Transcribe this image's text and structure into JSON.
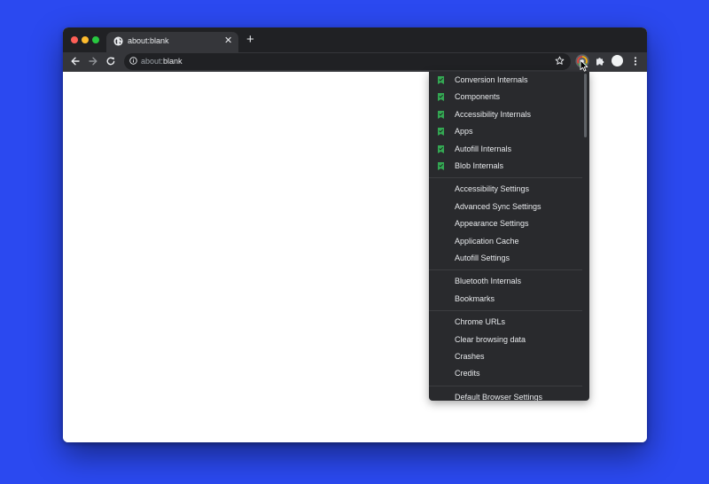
{
  "browser": {
    "tab": {
      "title": "about:blank",
      "close_glyph": "✕",
      "icon": "globe-icon"
    },
    "new_tab_glyph": "+",
    "address": {
      "scheme": "about:",
      "rest": "blank"
    },
    "toolbar_icons": [
      "back-icon",
      "forward-icon",
      "reload-icon",
      "info-icon",
      "star-icon",
      "extension-app-icon",
      "puzzle-icon",
      "avatar",
      "more-icon"
    ]
  },
  "menu": {
    "groups": [
      {
        "items": [
          {
            "label": "Conversion Internals",
            "checked": true
          },
          {
            "label": "Components",
            "checked": true
          },
          {
            "label": "Accessibility Internals",
            "checked": true
          },
          {
            "label": "Apps",
            "checked": true
          },
          {
            "label": "Autofill Internals",
            "checked": true
          },
          {
            "label": "Blob Internals",
            "checked": true
          }
        ]
      },
      {
        "items": [
          {
            "label": "Accessibility Settings",
            "checked": false
          },
          {
            "label": "Advanced Sync Settings",
            "checked": false
          },
          {
            "label": "Appearance Settings",
            "checked": false
          },
          {
            "label": "Application Cache",
            "checked": false
          },
          {
            "label": "Autofill Settings",
            "checked": false
          }
        ]
      },
      {
        "items": [
          {
            "label": "Bluetooth Internals",
            "checked": false
          },
          {
            "label": "Bookmarks",
            "checked": false
          }
        ]
      },
      {
        "items": [
          {
            "label": "Chrome URLs",
            "checked": false
          },
          {
            "label": "Clear browsing data",
            "checked": false
          },
          {
            "label": "Crashes",
            "checked": false
          },
          {
            "label": "Credits",
            "checked": false
          }
        ]
      },
      {
        "items": [
          {
            "label": "Default Browser Settings",
            "checked": false
          }
        ]
      }
    ]
  },
  "colors": {
    "background": "#2b49f0",
    "check_green": "#34a853",
    "menu_bg": "#292a2d",
    "tabstrip_bg": "#202124",
    "toolbar_bg": "#35363a"
  }
}
